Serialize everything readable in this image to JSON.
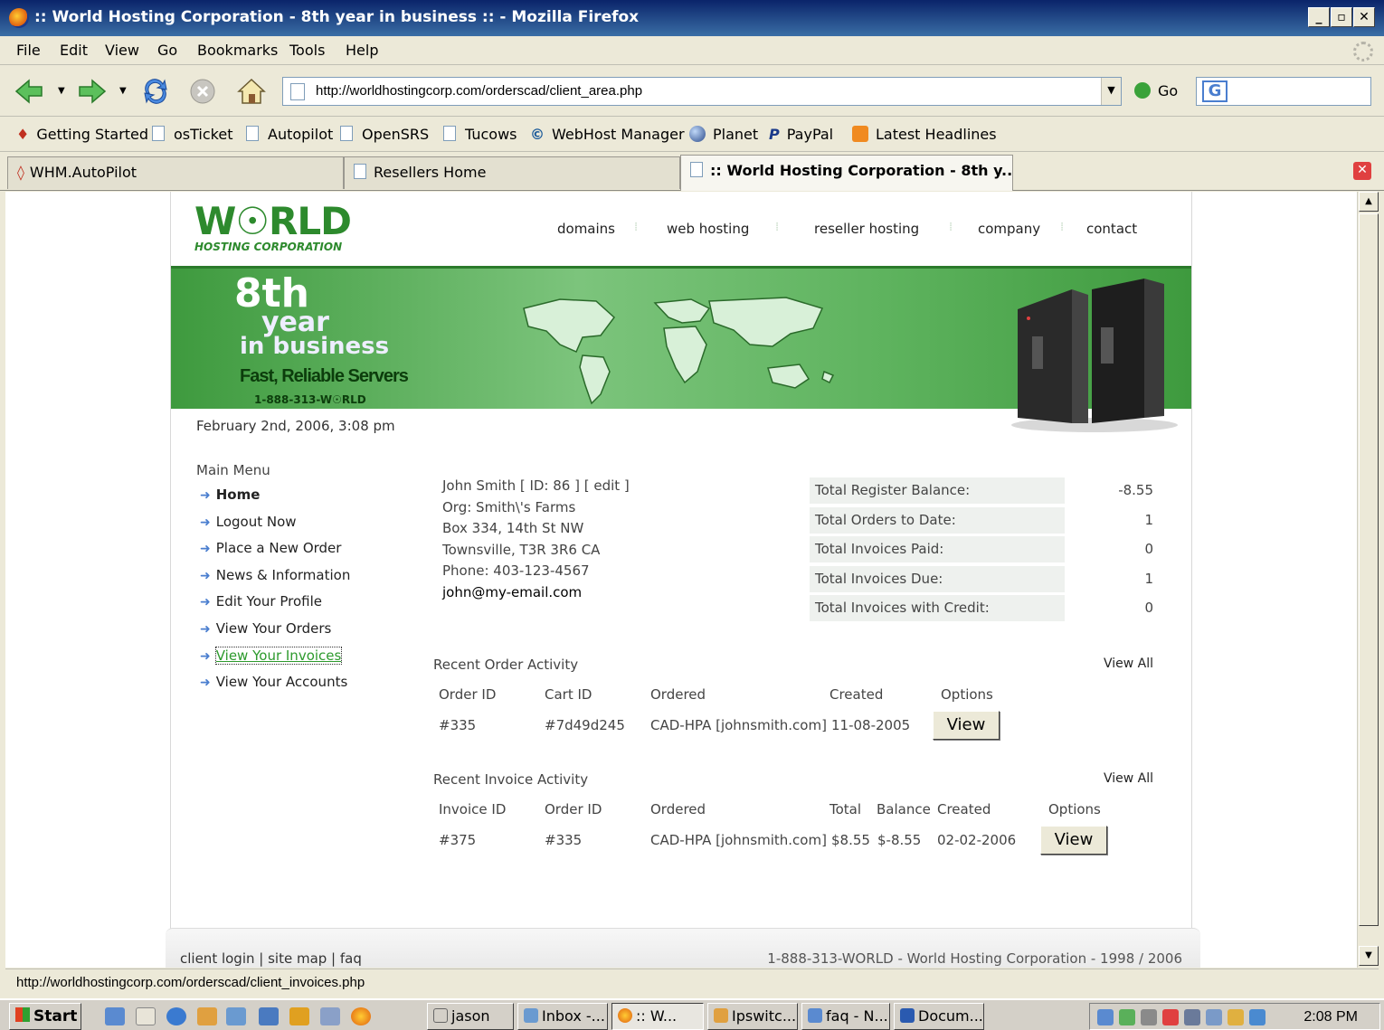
{
  "window": {
    "title": ":: World Hosting Corporation - 8th year in business :: - Mozilla Firefox"
  },
  "menubar": [
    "File",
    "Edit",
    "View",
    "Go",
    "Bookmarks",
    "Tools",
    "Help"
  ],
  "navbar": {
    "url": "http://worldhostingcorp.com/orderscad/client_area.php",
    "go_label": "Go",
    "search_engine_letter": "G"
  },
  "bookmarks": [
    "Getting Started",
    "osTicket",
    "Autopilot",
    "OpenSRS",
    "Tucows",
    "WebHost Manager",
    "Planet",
    "PayPal",
    "Latest Headlines"
  ],
  "tabs": [
    "WHM.AutoPilot",
    "Resellers Home",
    ":: World Hosting Corporation - 8th y..."
  ],
  "site": {
    "logo_word": "W☉RLD",
    "logo_sub": "HOSTING CORPORATION",
    "nav": [
      "domains",
      "web hosting",
      "reseller hosting",
      "company",
      "contact"
    ],
    "banner": {
      "l1": "8th",
      "l2": "year",
      "l3": "in business",
      "tagline": "Fast, Reliable Servers",
      "phone": "1-888-313-W☉RLD"
    },
    "date": "February 2nd, 2006, 3:08 pm"
  },
  "menu": {
    "heading": "Main Menu",
    "items": [
      "Home",
      "Logout Now",
      "Place a New Order",
      "News & Information",
      "Edit Your Profile",
      "View Your Orders",
      "View Your Invoices",
      "View Your Accounts"
    ]
  },
  "profile": {
    "line1": "John Smith  [ ID: 86 ]  [ edit ]",
    "org": "Org: Smith\\'s Farms",
    "addr1": "Box 334, 14th St NW",
    "addr2": "Townsville, T3R 3R6 CA",
    "phone": "Phone: 403-123-4567",
    "email": "john@my-email.com"
  },
  "totals": [
    {
      "label": "Total Register Balance:",
      "value": "-8.55"
    },
    {
      "label": "Total Orders to Date:",
      "value": "1"
    },
    {
      "label": "Total Invoices Paid:",
      "value": "0"
    },
    {
      "label": "Total Invoices Due:",
      "value": "1"
    },
    {
      "label": "Total Invoices with Credit:",
      "value": "0"
    }
  ],
  "orders": {
    "title": "Recent Order Activity",
    "view_all": "View All",
    "headers": [
      "Order ID",
      "Cart ID",
      "Ordered",
      "Created",
      "Options"
    ],
    "row": {
      "order_id": "#335",
      "cart_id": "#7d49d245",
      "ordered": "CAD-HPA [johnsmith.com]",
      "created": "11-08-2005",
      "button": "View"
    }
  },
  "invoices": {
    "title": "Recent Invoice Activity",
    "view_all": "View All",
    "headers": [
      "Invoice ID",
      "Order ID",
      "Ordered",
      "Total",
      "Balance",
      "Created",
      "Options"
    ],
    "row": {
      "invoice_id": "#375",
      "order_id": "#335",
      "ordered": "CAD-HPA [johnsmith.com]",
      "total": "$8.55",
      "balance": "$-8.55",
      "created": "02-02-2006",
      "button": "View"
    }
  },
  "footer": {
    "links": "client login  |  site map  |  faq",
    "right": "1-888-313-WORLD - World Hosting Corporation - 1998 / 2006"
  },
  "statusbar": "http://worldhostingcorp.com/orderscad/client_invoices.php",
  "taskbar": {
    "start": "Start",
    "tasks": [
      "jason",
      "Inbox -...",
      ":: W...",
      "Ipswitc...",
      "faq - N...",
      "Docum..."
    ],
    "clock": "2:08 PM"
  }
}
